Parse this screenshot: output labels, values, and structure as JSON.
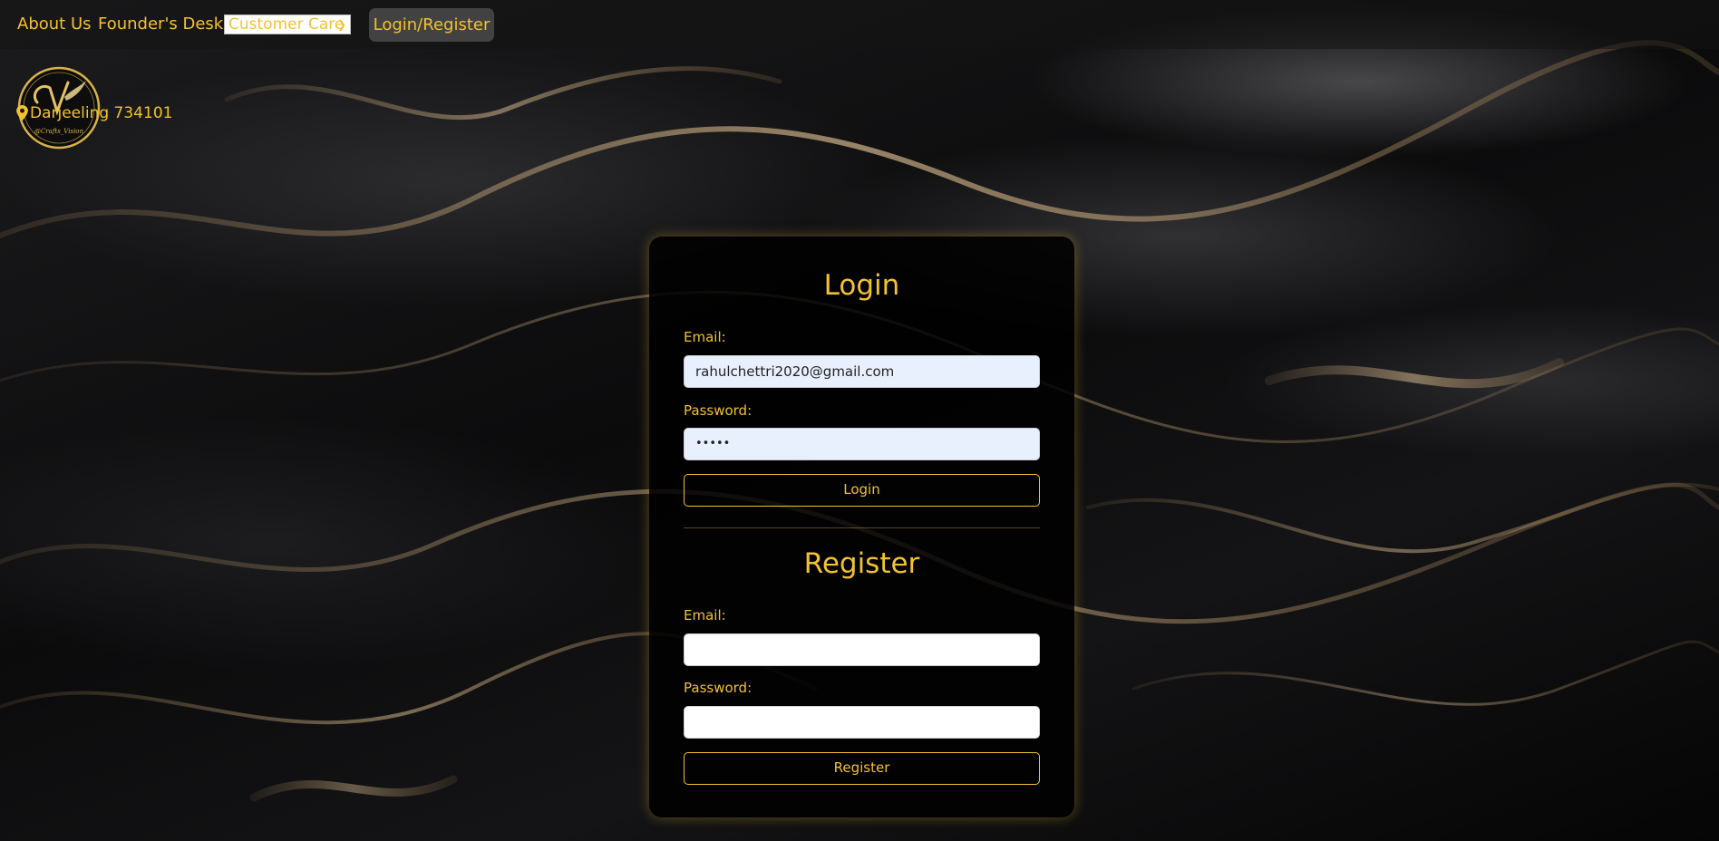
{
  "nav": {
    "about_label": "About Us",
    "founder_label": "Founder's Desk",
    "customer_care_label": "Customer Care",
    "login_register_label": "Login/Register"
  },
  "brand": {
    "location_text": "Darjeeling 734101",
    "logo_letters": "V",
    "logo_script": "@Crafts_Vision"
  },
  "login": {
    "title": "Login",
    "email_label": "Email:",
    "email_value": "rahulchettri2020@gmail.com",
    "password_label": "Password:",
    "password_value": "•••••",
    "button_label": "Login"
  },
  "register": {
    "title": "Register",
    "email_label": "Email:",
    "email_value": "",
    "password_label": "Password:",
    "password_value": "",
    "button_label": "Register"
  },
  "colors": {
    "accent": "#f2c230",
    "card_background": "#000000",
    "input_filled_background": "#e8f0fe"
  },
  "icons": {
    "location": "map-pin-icon",
    "dropdown": "chevron-down-icon"
  }
}
